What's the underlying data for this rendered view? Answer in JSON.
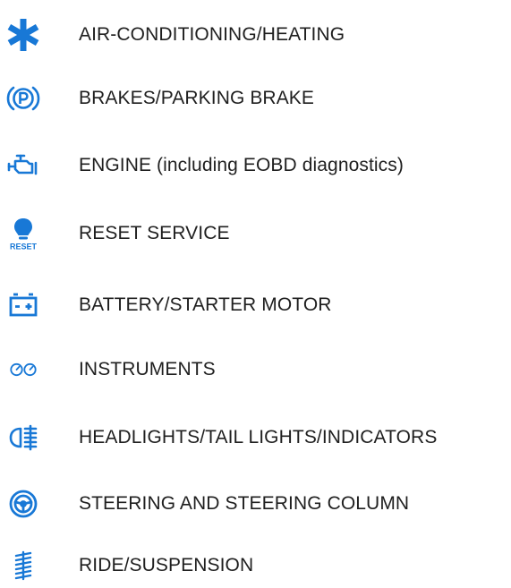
{
  "accent_color": "#1878d6",
  "text_color": "#1f1f1f",
  "categories": [
    {
      "icon": "air-conditioning-snowflake-icon",
      "label": "AIR-CONDITIONING/HEATING"
    },
    {
      "icon": "parking-brake-icon",
      "label": "BRAKES/PARKING BRAKE"
    },
    {
      "icon": "engine-icon",
      "label": "ENGINE (including EOBD diagnostics)"
    },
    {
      "icon": "reset-service-bulb-icon",
      "label": "RESET SERVICE",
      "icon_text": "RESET"
    },
    {
      "icon": "battery-icon",
      "label": "BATTERY/STARTER MOTOR"
    },
    {
      "icon": "instruments-gauges-icon",
      "label": "INSTRUMENTS"
    },
    {
      "icon": "headlight-icon",
      "label": "HEADLIGHTS/TAIL LIGHTS/INDICATORS"
    },
    {
      "icon": "steering-wheel-icon",
      "label": "STEERING AND STEERING COLUMN"
    },
    {
      "icon": "suspension-icon",
      "label": "RIDE/SUSPENSION"
    }
  ]
}
